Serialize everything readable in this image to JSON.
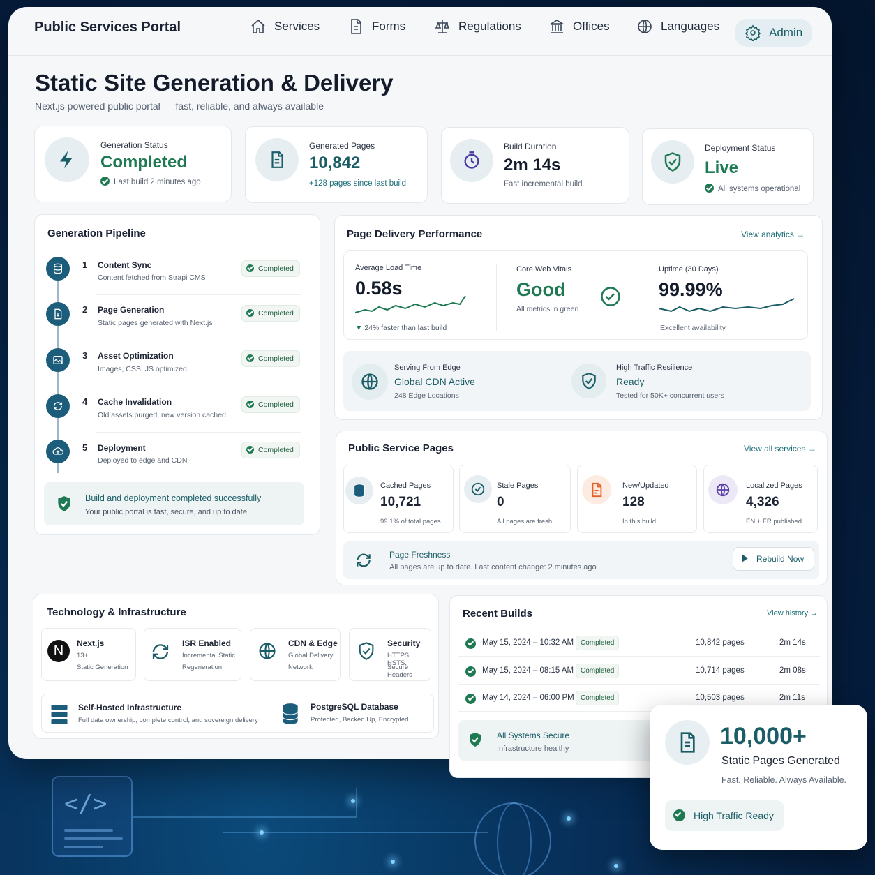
{
  "brand": "Public Services Portal",
  "nav": [
    {
      "label": "Services",
      "icon": "home-icon"
    },
    {
      "label": "Forms",
      "icon": "document-icon"
    },
    {
      "label": "Regulations",
      "icon": "scales-icon"
    },
    {
      "label": "Offices",
      "icon": "building-icon"
    },
    {
      "label": "Languages",
      "icon": "globe-icon"
    },
    {
      "label": "Admin",
      "icon": "gear-icon"
    }
  ],
  "page": {
    "title": "Static Site Generation & Delivery",
    "subtitle": "Next.js powered public portal — fast, reliable, and always available"
  },
  "stats": {
    "generation": {
      "label": "Generation Status",
      "value": "Completed",
      "sub": "Last build 2 minutes ago"
    },
    "pages": {
      "label": "Generated Pages",
      "value": "10,842",
      "sub": "+128 pages since last build"
    },
    "duration": {
      "label": "Build Duration",
      "value": "2m 14s",
      "sub": "Fast incremental build"
    },
    "deployment": {
      "label": "Deployment Status",
      "value": "Live",
      "sub": "All systems operational"
    }
  },
  "pipeline": {
    "title": "Generation Pipeline",
    "steps": [
      {
        "num": "1",
        "title": "Content Sync",
        "desc": "Content fetched from Strapi CMS",
        "status": "Completed"
      },
      {
        "num": "2",
        "title": "Page Generation",
        "desc": "Static pages generated with Next.js",
        "status": "Completed"
      },
      {
        "num": "3",
        "title": "Asset Optimization",
        "desc": "Images, CSS, JS optimized",
        "status": "Completed"
      },
      {
        "num": "4",
        "title": "Cache Invalidation",
        "desc": "Old assets purged, new version cached",
        "status": "Completed"
      },
      {
        "num": "5",
        "title": "Deployment",
        "desc": "Deployed to edge and CDN",
        "status": "Completed"
      }
    ],
    "success_title": "Build and deployment completed successfully",
    "success_desc": "Your public portal is fast, secure, and up to date."
  },
  "delivery": {
    "title": "Page Delivery Performance",
    "link": "View analytics",
    "load": {
      "label": "Average Load Time",
      "value": "0.58s",
      "sub": "24% faster than last build"
    },
    "vitals": {
      "label": "Core Web Vitals",
      "value": "Good",
      "sub": "All metrics in green"
    },
    "uptime": {
      "label": "Uptime (30 Days)",
      "value": "99.99%",
      "sub": "Excellent availability"
    },
    "cdn": {
      "label": "Serving From Edge",
      "value": "Global CDN Active",
      "sub": "248 Edge Locations"
    },
    "traffic": {
      "label": "High Traffic Resilience",
      "value": "Ready",
      "sub": "Tested for 50K+ concurrent users"
    }
  },
  "service_pages": {
    "title": "Public Service Pages",
    "link": "View all services",
    "items": [
      {
        "label": "Cached Pages",
        "value": "10,721",
        "sub": "99.1% of total pages"
      },
      {
        "label": "Stale Pages",
        "value": "0",
        "sub": "All pages are fresh"
      },
      {
        "label": "New/Updated",
        "value": "128",
        "sub": "In this build"
      },
      {
        "label": "Localized Pages",
        "value": "4,326",
        "sub": "EN + FR published"
      }
    ],
    "freshness_title": "Page Freshness",
    "freshness_desc": "All pages are up to date. Last content change: 2 minutes ago",
    "rebuild": "Rebuild Now"
  },
  "tech": {
    "title": "Technology & Infrastructure",
    "items": [
      {
        "title": "Next.js",
        "l1": "13+",
        "l2": "Static Generation"
      },
      {
        "title": "ISR Enabled",
        "l1": "Incremental Static",
        "l2": "Regeneration"
      },
      {
        "title": "CDN & Edge",
        "l1": "Global Delivery",
        "l2": "Network"
      },
      {
        "title": "Security",
        "l1": "HTTPS, HSTS,",
        "l2": "Secure Headers"
      }
    ],
    "selfhost_title": "Self-Hosted Infrastructure",
    "selfhost_desc": "Full data ownership, complete control, and sovereign delivery",
    "db_title": "PostgreSQL Database",
    "db_desc": "Protected, Backed Up, Encrypted"
  },
  "builds": {
    "title": "Recent Builds",
    "link": "View history",
    "rows": [
      {
        "date": "May 15, 2024 – 10:32 AM",
        "status": "Completed",
        "pages": "10,842 pages",
        "time": "2m 14s"
      },
      {
        "date": "May 15, 2024 – 08:15 AM",
        "status": "Completed",
        "pages": "10,714 pages",
        "time": "2m 08s"
      },
      {
        "date": "May 14, 2024 – 06:00 PM",
        "status": "Completed",
        "pages": "10,503 pages",
        "time": "2m 11s"
      }
    ],
    "secure_title": "All Systems Secure",
    "secure_desc": "Infrastructure healthy"
  },
  "promo": {
    "value": "10,000+",
    "title": "Static Pages Generated",
    "tagline": "Fast. Reliable. Always Available.",
    "badge": "High Traffic Ready"
  },
  "colors": {
    "accent": "#1b5d66",
    "success": "#1f7a54",
    "background": "#051d3d"
  }
}
